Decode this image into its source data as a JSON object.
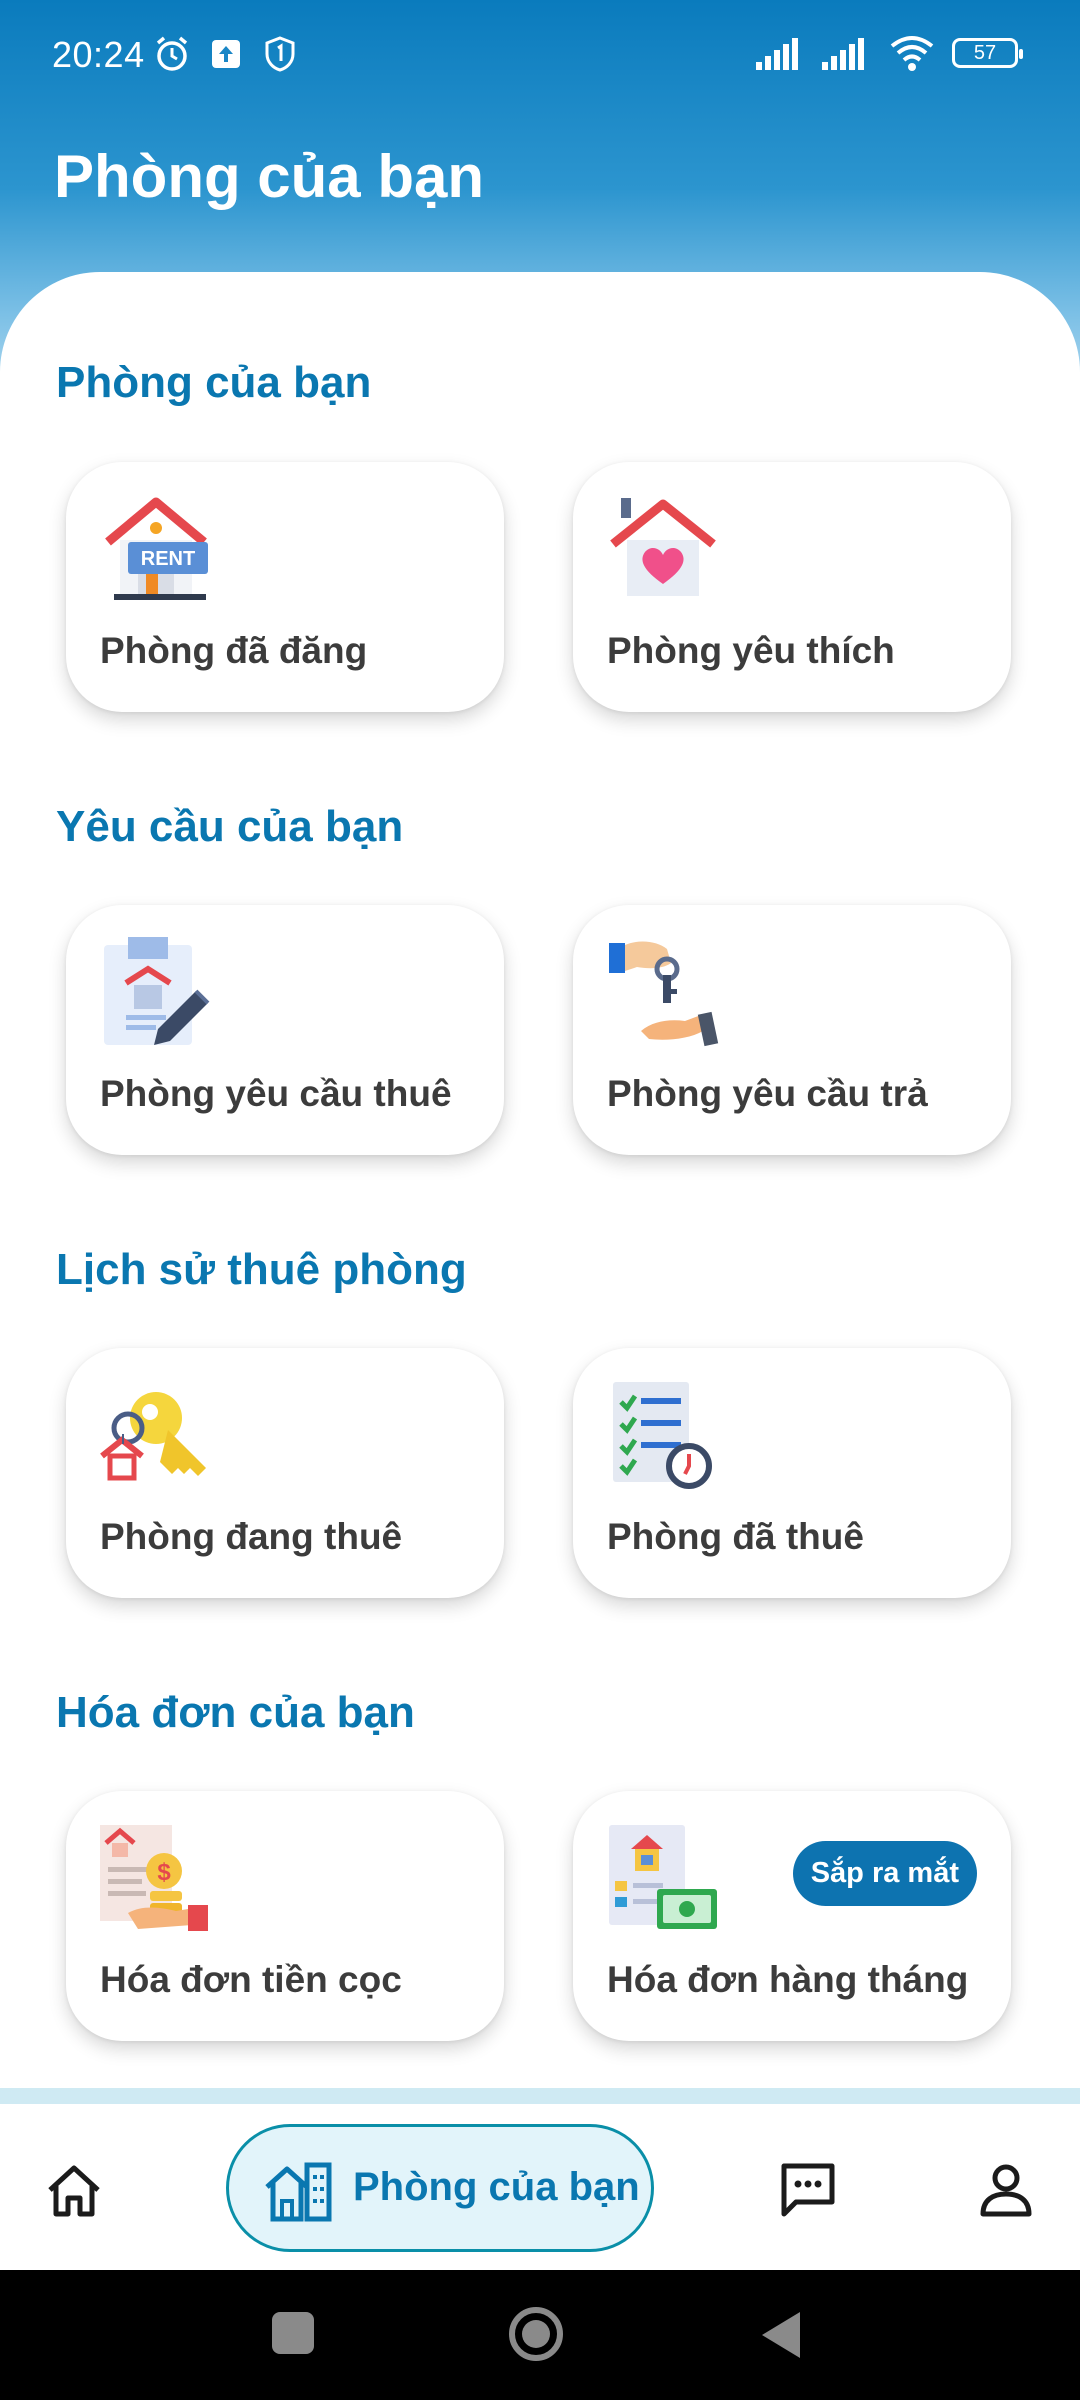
{
  "status_bar": {
    "time": "20:24",
    "battery": "57"
  },
  "header": {
    "title": "Phòng của bạn"
  },
  "sections": [
    {
      "title": "Phòng của bạn",
      "cards": [
        {
          "label": "Phòng đã đăng",
          "icon": "rent-house-icon"
        },
        {
          "label": "Phòng yêu thích",
          "icon": "heart-house-icon"
        }
      ]
    },
    {
      "title": "Yêu cầu của bạn",
      "cards": [
        {
          "label": "Phòng yêu cầu thuê",
          "icon": "rental-contract-icon"
        },
        {
          "label": "Phòng yêu cầu trả",
          "icon": "key-handover-icon"
        }
      ]
    },
    {
      "title": "Lịch sử thuê phòng",
      "cards": [
        {
          "label": "Phòng đang thuê",
          "icon": "house-key-icon"
        },
        {
          "label": "Phòng đã thuê",
          "icon": "checklist-clock-icon"
        }
      ]
    },
    {
      "title": "Hóa đơn của bạn",
      "cards": [
        {
          "label": "Hóa đơn tiền cọc",
          "icon": "deposit-invoice-icon"
        },
        {
          "label": "Hóa đơn hàng tháng",
          "icon": "monthly-bill-icon",
          "badge": "Sắp ra mắt"
        }
      ]
    }
  ],
  "bottom_nav": {
    "items": [
      {
        "name": "home",
        "icon": "home-icon"
      },
      {
        "name": "rooms",
        "icon": "building-icon",
        "label": "Phòng của bạn",
        "active": true
      },
      {
        "name": "messages",
        "icon": "chat-icon"
      },
      {
        "name": "profile",
        "icon": "user-icon"
      }
    ]
  },
  "colors": {
    "primary": "#0a77b0",
    "header_top": "#0a7bbd",
    "badge": "#0d73b0",
    "pill_bg": "#e2f4fa"
  }
}
